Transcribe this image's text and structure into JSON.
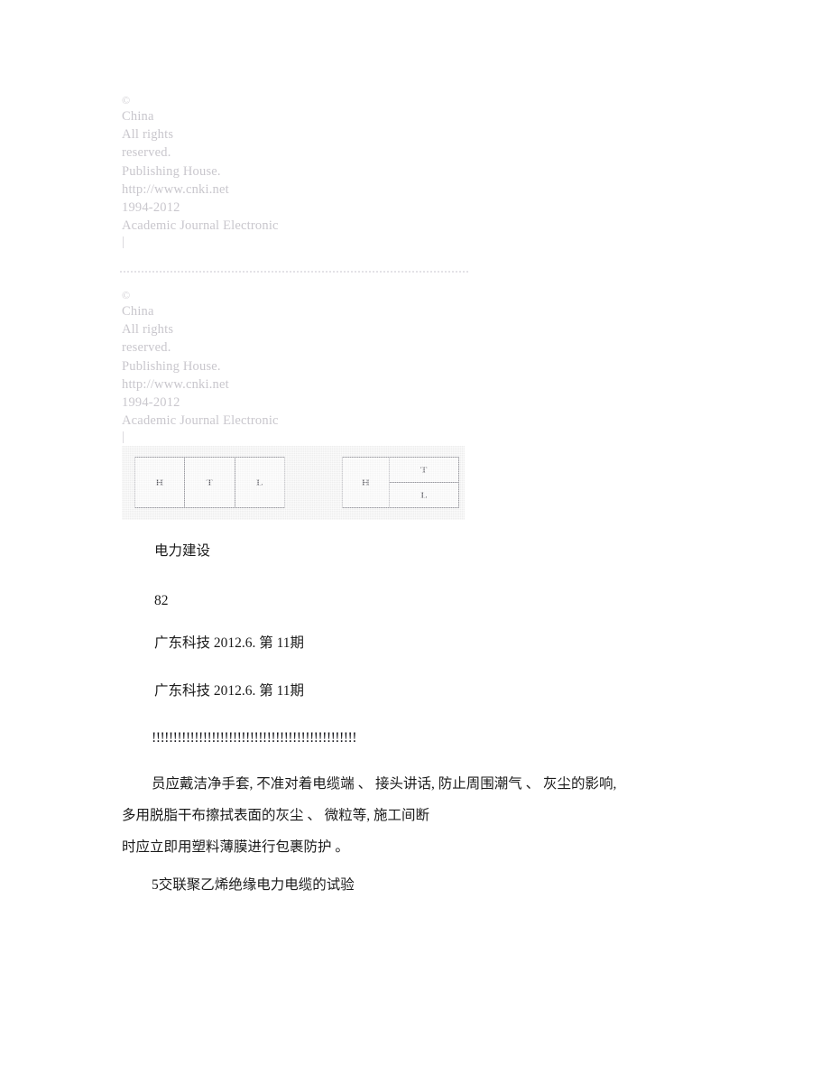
{
  "document": {
    "watermark": {
      "copyright_symbol": "©",
      "lines": [
        "China",
        "All rights",
        "reserved.",
        "Publishing House.",
        "http://www.cnki.net",
        "1994-2012",
        "Academic Journal Electronic"
      ],
      "trailing_bar": "|"
    },
    "figure": {
      "left_table": {
        "cells": [
          "H",
          "T",
          "L"
        ]
      },
      "right_table": {
        "left_cell": "H",
        "right_cells": [
          "T",
          "L"
        ]
      }
    },
    "body": {
      "caption": "电力建设",
      "page_number": "82",
      "journal_line_1": "广东科技 2012.6. 第 11期",
      "journal_line_2": "广东科技 2012.6. 第 11期",
      "separator_bangs": "!!!!!!!!!!!!!!!!!!!!!!!!!!!!!!!!!!!!!!!!!!!!!!!!",
      "paragraph_line_1": "员应戴洁净手套, 不准对着电缆端 、 接头讲话, 防止周围潮气 、 灰尘的影响,",
      "paragraph_line_2": "多用脱脂干布擦拭表面的灰尘 、 微粒等, 施工间断",
      "paragraph_line_3": "时应立即用塑料薄膜进行包裹防护 。",
      "heading": "5交联聚乙烯绝缘电力电缆的试验"
    },
    "colors": {
      "watermark": "#c9c7cd",
      "body_text": "#1b1b1b",
      "figure_background": "#eeeeee",
      "table_border": "#9a9aa0"
    }
  }
}
